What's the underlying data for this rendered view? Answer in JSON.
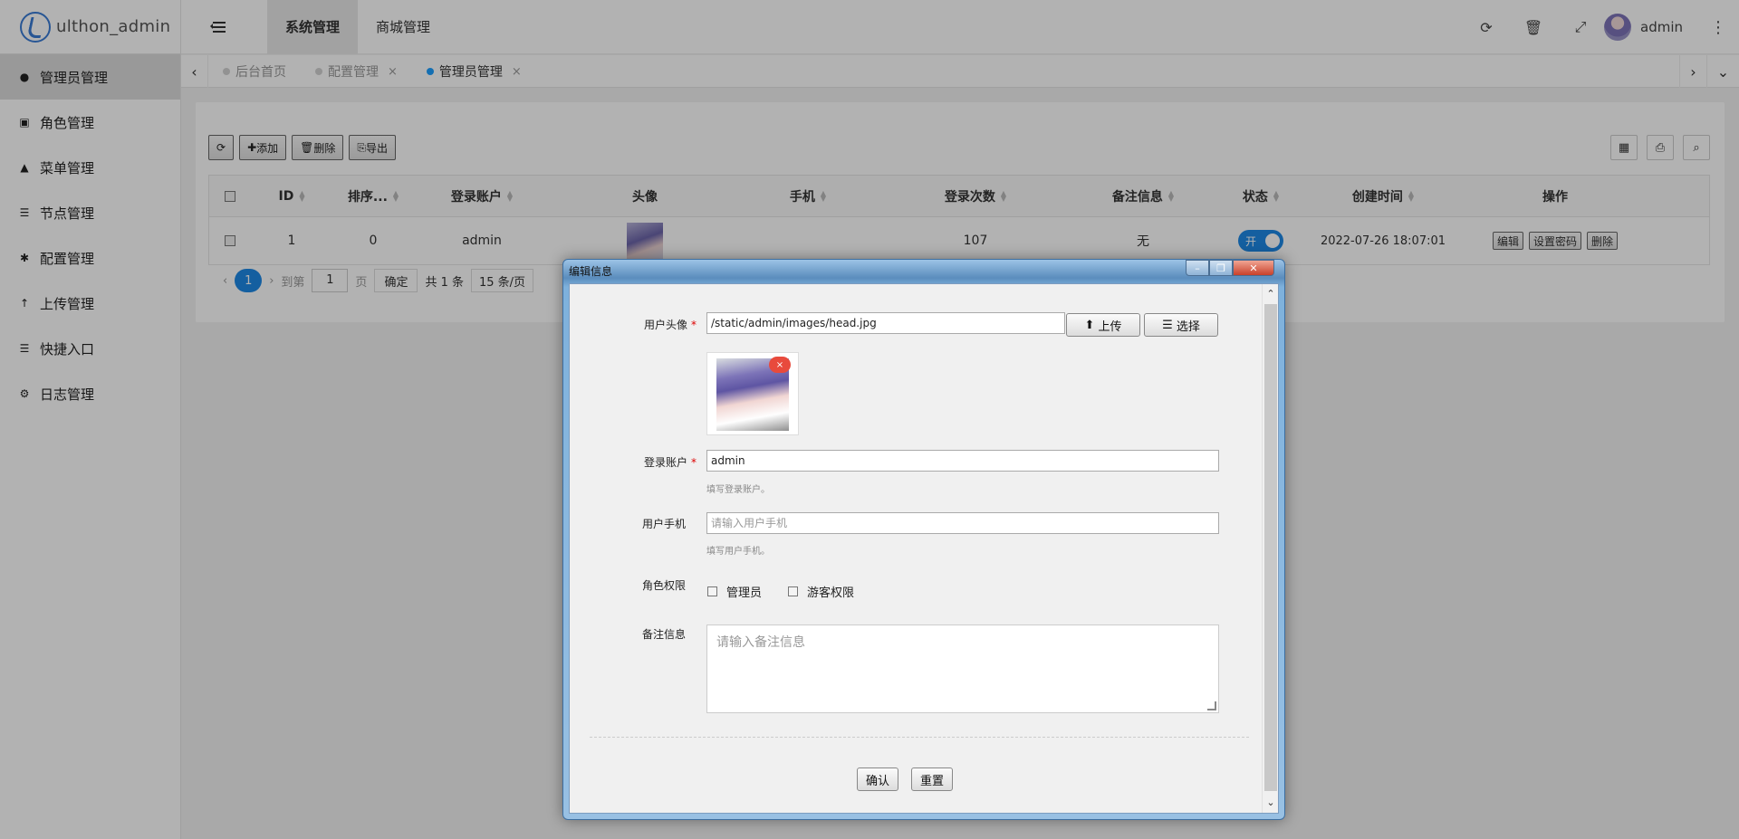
{
  "app": {
    "title": "ulthon_admin"
  },
  "header": {
    "nav": [
      "系统管理",
      "商城管理"
    ],
    "active_nav": 0,
    "user": "admin"
  },
  "sidebar": {
    "items": [
      {
        "label": "管理员管理",
        "icon": "user-icon"
      },
      {
        "label": "角色管理",
        "icon": "badge-icon"
      },
      {
        "label": "菜单管理",
        "icon": "tree-icon"
      },
      {
        "label": "节点管理",
        "icon": "list-icon"
      },
      {
        "label": "配置管理",
        "icon": "asterisk-icon"
      },
      {
        "label": "上传管理",
        "icon": "arrow-up-icon"
      },
      {
        "label": "快捷入口",
        "icon": "list-icon"
      },
      {
        "label": "日志管理",
        "icon": "cog-outline-icon"
      }
    ]
  },
  "tabs": [
    {
      "label": "后台首页",
      "closable": false
    },
    {
      "label": "配置管理",
      "closable": true
    },
    {
      "label": "管理员管理",
      "closable": true,
      "active": true
    }
  ],
  "toolbar": {
    "add": "添加",
    "delete": "删除",
    "export": "导出"
  },
  "table": {
    "headers": [
      "ID",
      "排序...",
      "登录账户",
      "头像",
      "手机",
      "登录次数",
      "备注信息",
      "状态",
      "创建时间",
      "操作"
    ],
    "rows": [
      {
        "id": "1",
        "sort": "0",
        "account": "admin",
        "phone": "",
        "logins": "107",
        "remark": "无",
        "status": "开",
        "created": "2022-07-26 18:07:01"
      }
    ],
    "actions": [
      "编辑",
      "设置密码",
      "删除"
    ]
  },
  "pager": {
    "current": "1",
    "goto_label": "到第",
    "page_input": "1",
    "page_unit": "页",
    "confirm": "确定",
    "total": "共 1 条",
    "per_page": "15 条/页"
  },
  "modal": {
    "title": "编辑信息",
    "avatar_label": "用户头像",
    "avatar_value": "/static/admin/images/head.jpg",
    "upload": "上传",
    "select": "选择",
    "account_label": "登录账户",
    "account_value": "admin",
    "account_hint": "填写登录账户。",
    "phone_label": "用户手机",
    "phone_placeholder": "请输入用户手机",
    "phone_hint": "填写用户手机。",
    "role_label": "角色权限",
    "roles": [
      "管理员",
      "游客权限"
    ],
    "remark_label": "备注信息",
    "remark_placeholder": "请输入备注信息",
    "confirm": "确认",
    "reset": "重置"
  },
  "colors": {
    "accent": "#1e88e5",
    "danger": "#e84a3c"
  }
}
